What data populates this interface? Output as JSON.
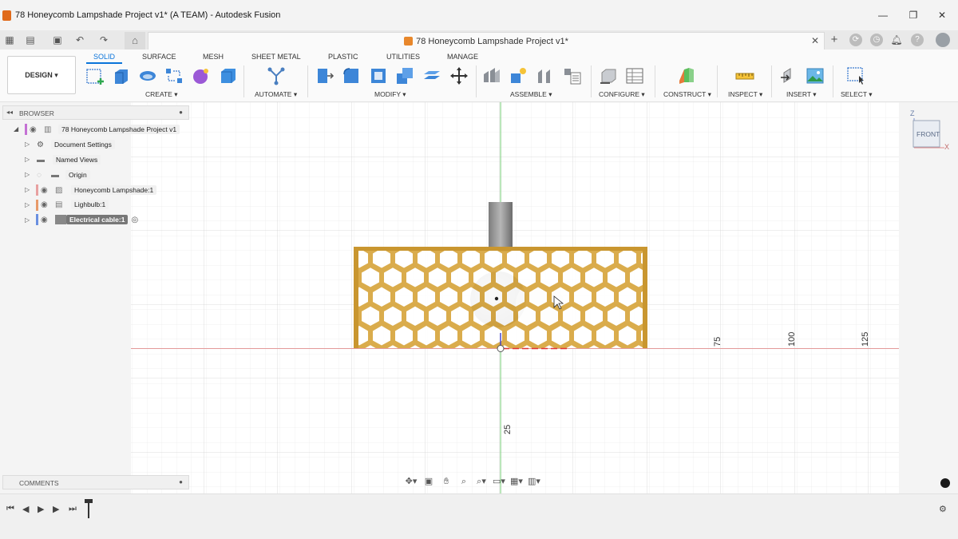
{
  "window": {
    "title": "78 Honeycomb Lampshade Project v1* (A TEAM) - Autodesk Fusion",
    "min_icon": "minimize-icon",
    "max_icon": "maximize-icon",
    "close_icon": "close-icon"
  },
  "doc_tab": {
    "title": "78 Honeycomb Lampshade Project v1*"
  },
  "workspace": {
    "label": "DESIGN"
  },
  "ribbon": {
    "tabs": [
      "SOLID",
      "SURFACE",
      "MESH",
      "SHEET METAL",
      "PLASTIC",
      "UTILITIES",
      "MANAGE"
    ],
    "active_tab": "SOLID",
    "groups": [
      "CREATE",
      "AUTOMATE",
      "MODIFY",
      "ASSEMBLE",
      "CONFIGURE",
      "CONSTRUCT",
      "INSPECT",
      "INSERT",
      "SELECT"
    ]
  },
  "browser": {
    "title": "BROWSER",
    "items": [
      {
        "label": "78 Honeycomb Lampshade Project v1"
      },
      {
        "label": "Document Settings"
      },
      {
        "label": "Named Views"
      },
      {
        "label": "Origin"
      },
      {
        "label": "Honeycomb Lampshade:1"
      },
      {
        "label": "Lighbulb:1"
      },
      {
        "label": "Electrical cable:1"
      }
    ]
  },
  "comments": {
    "title": "COMMENTS"
  },
  "viewcube": {
    "face": "FRONT",
    "axis_z": "Z",
    "axis_x": "X"
  },
  "ruler": {
    "h_labels": [
      "75",
      "100",
      "125"
    ],
    "v_label": "25"
  },
  "colors": {
    "accent": "#0a74da",
    "honeycomb": "#d9a53a",
    "x_axis": "#e07a7a",
    "y_axis": "#6ccf6c"
  }
}
